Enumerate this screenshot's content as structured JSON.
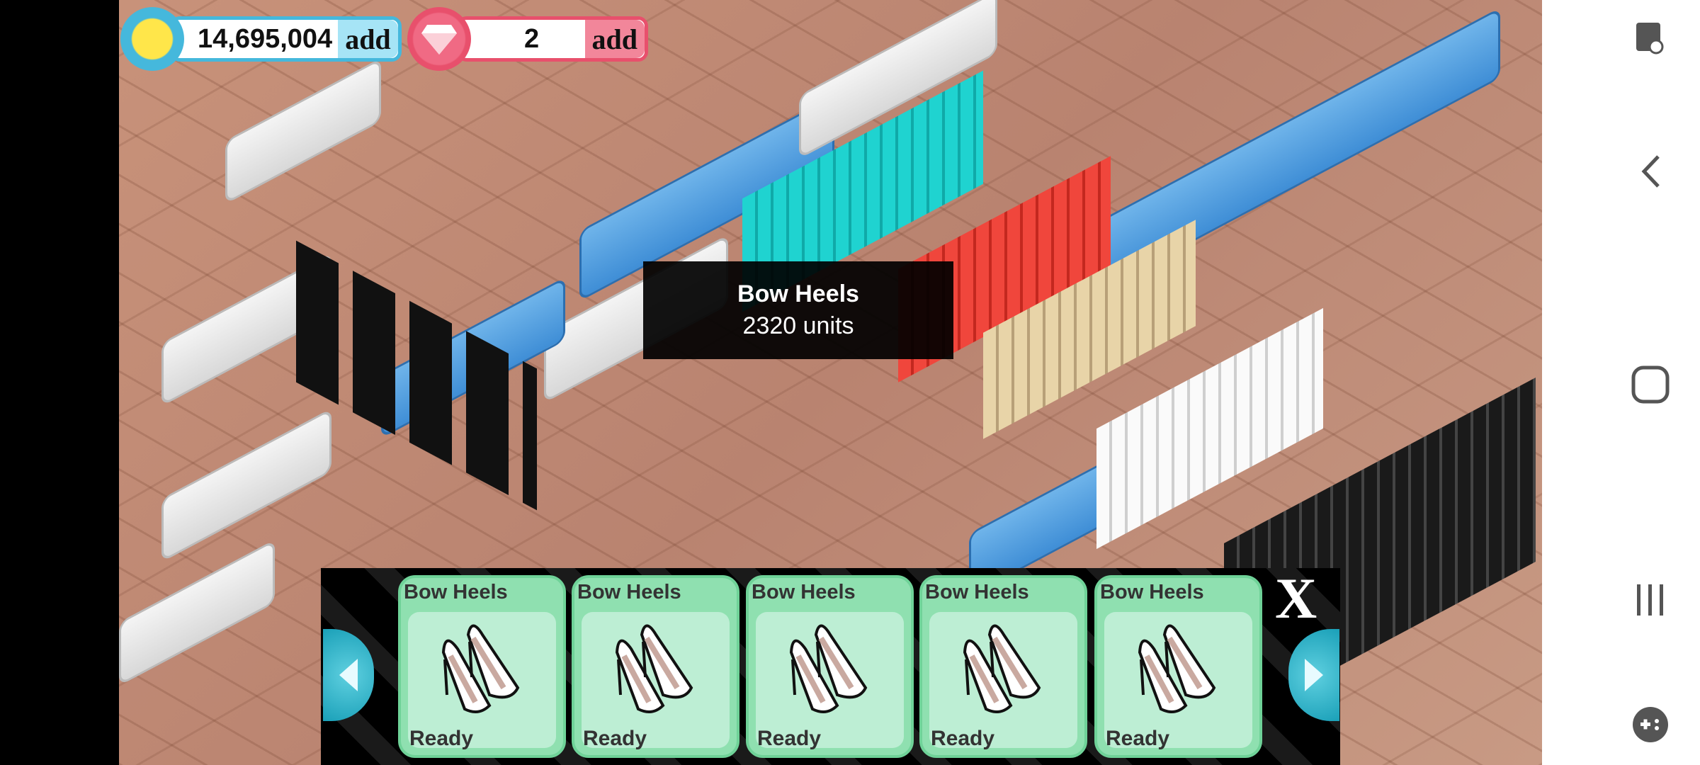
{
  "currency": {
    "coins": "14,695,004",
    "coins_add": "add",
    "gems": "2",
    "gems_add": "add"
  },
  "tooltip": {
    "item": "Bow Heels",
    "units": "2320 units"
  },
  "tray": {
    "cards": [
      {
        "name": "Bow Heels",
        "status": "Ready"
      },
      {
        "name": "Bow Heels",
        "status": "Ready"
      },
      {
        "name": "Bow Heels",
        "status": "Ready"
      },
      {
        "name": "Bow Heels",
        "status": "Ready"
      },
      {
        "name": "Bow Heels",
        "status": "Ready"
      }
    ],
    "close_label": "X"
  },
  "colors": {
    "coin_accent": "#45b8dc",
    "gem_accent": "#e8506c",
    "card_bg": "#8fe0b0"
  }
}
